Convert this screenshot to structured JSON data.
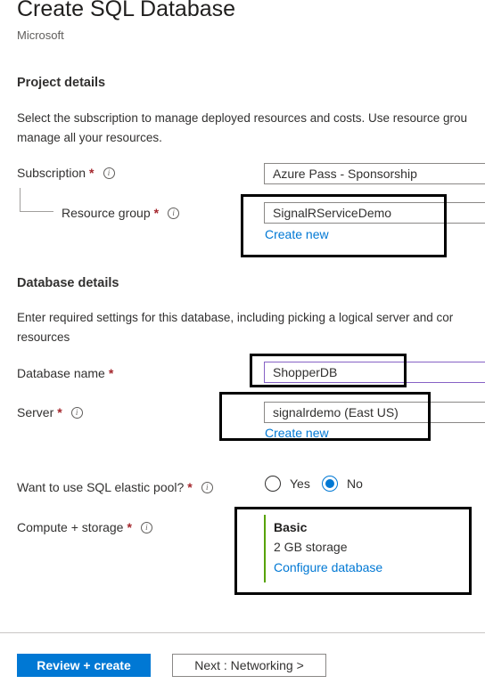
{
  "header": {
    "title": "Create SQL Database",
    "publisher": "Microsoft"
  },
  "project": {
    "heading": "Project details",
    "desc_line1": "Select the subscription to manage deployed resources and costs. Use resource grou",
    "desc_line2": "manage all your resources.",
    "subscription": {
      "label": "Subscription",
      "value": "Azure Pass - Sponsorship"
    },
    "resource_group": {
      "label": "Resource group",
      "value": "SignalRServiceDemo",
      "create_new": "Create new"
    }
  },
  "database": {
    "heading": "Database details",
    "desc_line1": "Enter required settings for this database, including picking a logical server and cor",
    "desc_line2": "resources",
    "name": {
      "label": "Database name",
      "value": "ShopperDB"
    },
    "server": {
      "label": "Server",
      "value": "signalrdemo (East US)",
      "create_new": "Create new"
    },
    "elastic_pool": {
      "label": "Want to use SQL elastic pool?",
      "yes": "Yes",
      "no": "No",
      "selected": "No"
    },
    "compute": {
      "label": "Compute + storage",
      "tier": "Basic",
      "storage": "2 GB storage",
      "configure": "Configure database"
    }
  },
  "footer": {
    "review_create": "Review + create",
    "next": "Next : Networking >"
  },
  "common": {
    "required_mark": "*",
    "info_glyph": "i"
  },
  "colors": {
    "accent": "#0078d4",
    "required": "#a4262c",
    "sku_bar": "#57a300",
    "highlight_box": "#000000"
  }
}
